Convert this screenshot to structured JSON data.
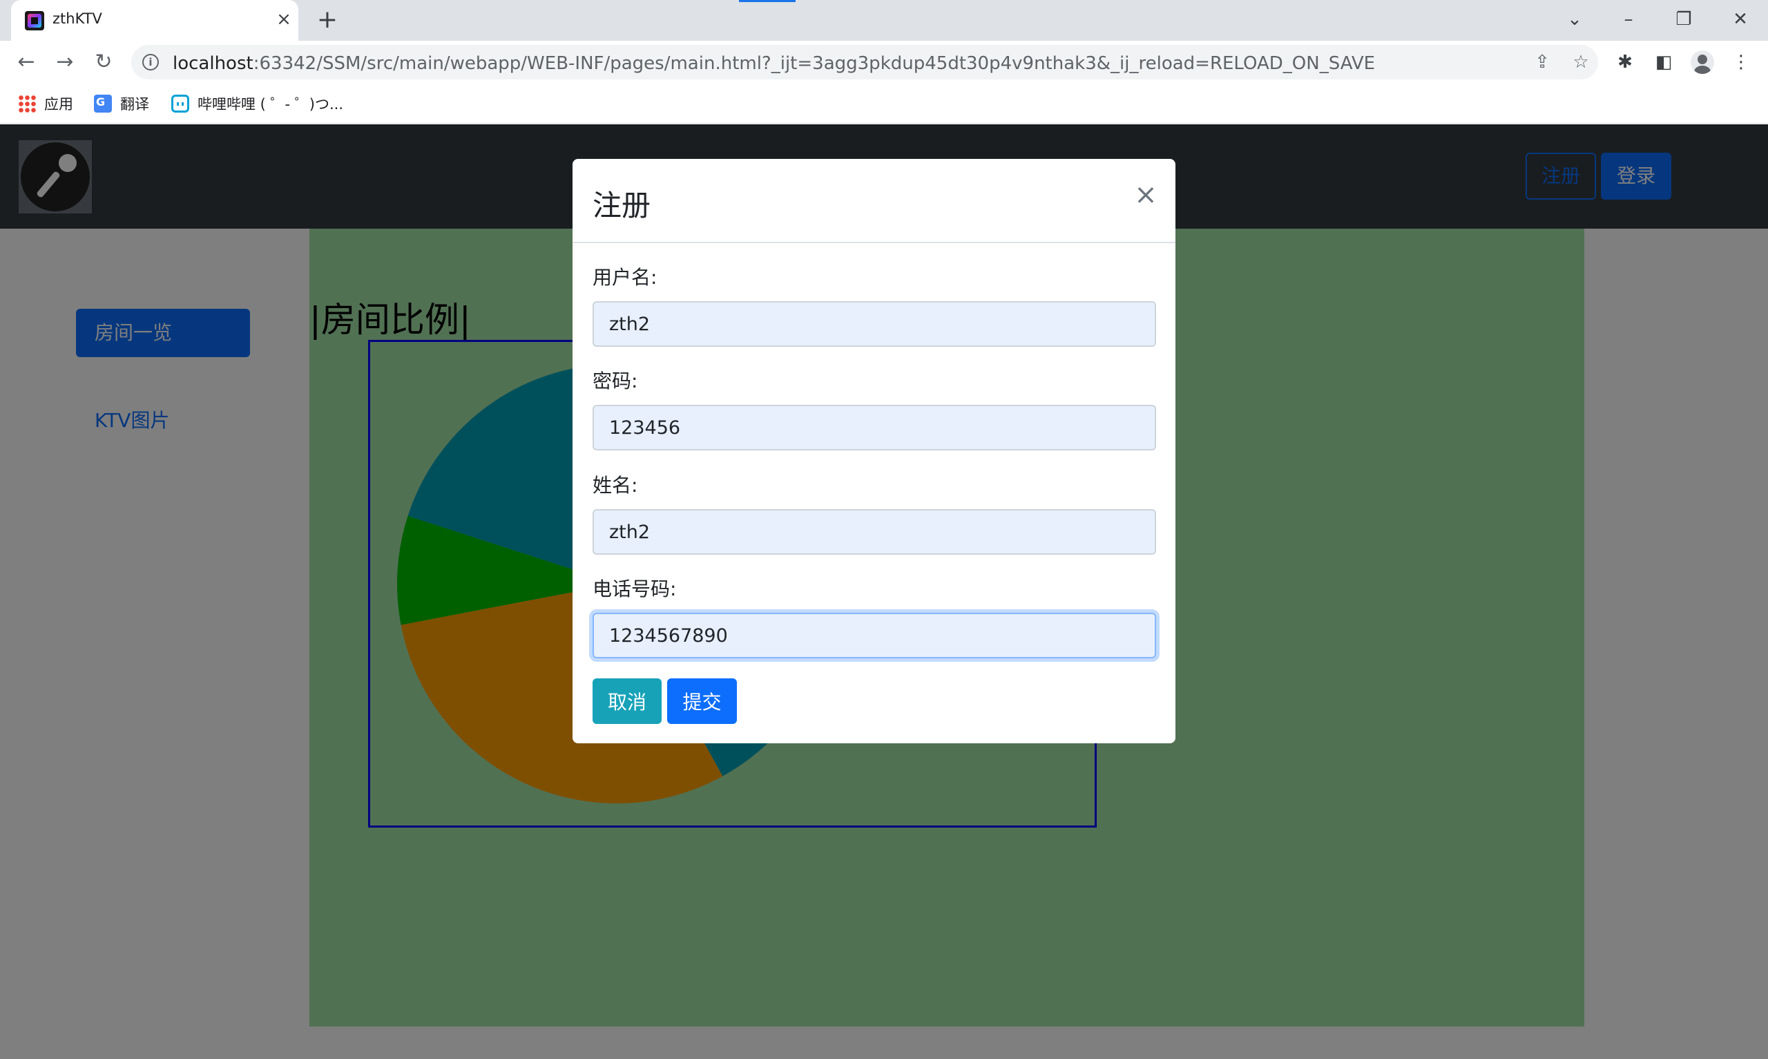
{
  "browser": {
    "tab_title": "zthKTV",
    "url_host": "localhost",
    "url_rest": ":63342/SSM/src/main/webapp/WEB-INF/pages/main.html?_ijt=3agg3pkdup45dt30p4v9nthak3&_ij_reload=RELOAD_ON_SAVE",
    "bookmarks": [
      {
        "label": "应用",
        "icon": "apps-icon"
      },
      {
        "label": "翻译",
        "icon": "translate-icon"
      },
      {
        "label": "哔哩哔哩 ( ゜- ゜)つ...",
        "icon": "bilibili-icon"
      }
    ]
  },
  "navbar": {
    "register_label": "注册",
    "login_label": "登录"
  },
  "sidebar": {
    "items": [
      {
        "label": "房间一览",
        "active": true
      },
      {
        "label": "KTV图片",
        "active": false
      }
    ]
  },
  "main": {
    "section_title": "|房间比例|"
  },
  "chart_data": {
    "type": "pie",
    "note_visible": "partially occluded by modal; slice values estimated",
    "series": [
      {
        "color": "#00a0b8",
        "value": 45
      },
      {
        "color": "#ff9f00",
        "value": 30
      },
      {
        "color": "#00c000",
        "value": 8
      },
      {
        "color": "#00a0b8",
        "value": 17
      }
    ]
  },
  "modal": {
    "title": "注册",
    "close_symbol": "×",
    "fields": [
      {
        "label": "用户名:",
        "value": "zth2"
      },
      {
        "label": "密码:",
        "value": "123456"
      },
      {
        "label": "姓名:",
        "value": "zth2"
      },
      {
        "label": "电话号码:",
        "value": "1234567890"
      }
    ],
    "cancel_label": "取消",
    "submit_label": "提交"
  },
  "colors": {
    "navbar_bg": "#343a40",
    "primary": "#0d6efd",
    "info": "#17a2b8",
    "content_bg": "#a3e2a7",
    "input_autofill_bg": "#e8f0fe"
  }
}
